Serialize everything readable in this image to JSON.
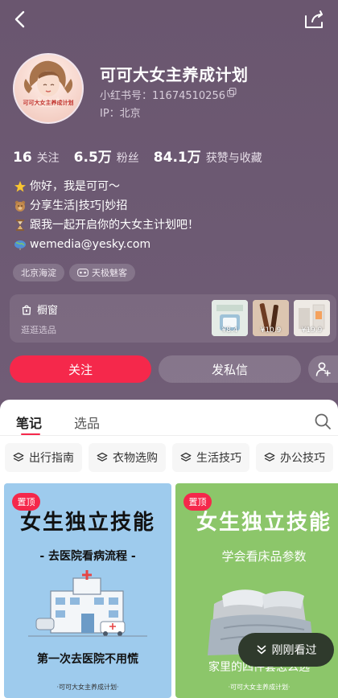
{
  "profile": {
    "name": "可可大女主养成计划",
    "id_text": "小红书号：11674510256",
    "ip_text": "IP：北京",
    "avatar_text": "可可大女主养成计划"
  },
  "stats": [
    {
      "value": "16",
      "label": "关注"
    },
    {
      "value": "6.5万",
      "label": "粉丝"
    },
    {
      "value": "84.1万",
      "label": "获赞与收藏"
    }
  ],
  "bio": [
    {
      "icon": "star-icon",
      "text": "你好，我是可可～"
    },
    {
      "icon": "bear-icon",
      "text": "分享生活|技巧|妙招"
    },
    {
      "icon": "hourglass-icon",
      "text": "跟我一起开启你的大女主计划吧！"
    },
    {
      "icon": "globe-icon",
      "text": "wemedia@yesky.com"
    }
  ],
  "tags": [
    {
      "label": "北京海淀",
      "icon": null
    },
    {
      "label": "天极魅客",
      "icon": "vr-icon"
    }
  ],
  "shop": {
    "title": "橱窗",
    "subtitle": "逛逛选品",
    "items": [
      {
        "price": "¥8.4",
        "color": "#cfd9d2"
      },
      {
        "price": "¥10.9",
        "color": "#d2b6a0"
      },
      {
        "price": "¥19.9",
        "color": "#e7e2dc"
      }
    ]
  },
  "actions": {
    "follow": "关注",
    "message": "发私信"
  },
  "tabs": [
    {
      "label": "笔记",
      "active": true
    },
    {
      "label": "选品",
      "active": false
    }
  ],
  "chips": [
    "出行指南",
    "衣物选购",
    "生活技巧",
    "办公技巧"
  ],
  "posts": [
    {
      "badge": "置顶",
      "title": "女生独立技能",
      "subtitle": "- 去医院看病流程 -",
      "caption": "第一次去医院不用慌",
      "footer": "·可可大女主养成计划·"
    },
    {
      "badge": "置顶",
      "title": "女生独立技能",
      "subtitle": "学会看床品参数",
      "caption": "家里的四件套怎么选",
      "footer": "·可可大女主养成计划·"
    }
  ],
  "just_viewed": "刚刚看过",
  "colors": {
    "accent": "#f5284b",
    "header": "#6e5a74",
    "card_blue": "#9ecbed",
    "card_green": "#8cc66a"
  }
}
